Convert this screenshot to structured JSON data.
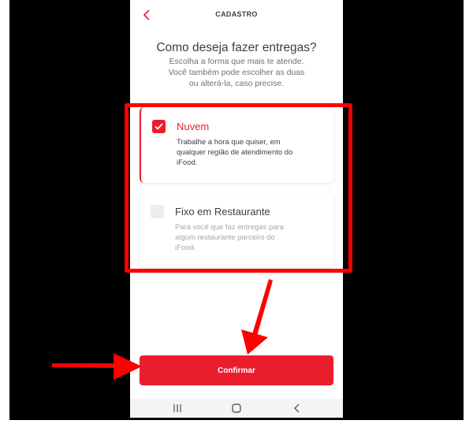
{
  "header": {
    "back_icon": "chevron-left-icon",
    "title": "CADASTRO"
  },
  "question": {
    "title": "Como deseja fazer entregas?",
    "subtitle_lines": [
      "Escolha a forma que mais te atende.",
      "Você também pode escolher as duas",
      "ou alterá-la, caso precise."
    ]
  },
  "options": [
    {
      "label": "Nuvem",
      "selected": true,
      "description_lines": [
        "Trabalhe a hora que quiser, em",
        "qualquer região de atendimento do",
        "iFood."
      ]
    },
    {
      "label": "Fixo em Restaurante",
      "selected": false,
      "description_lines": [
        "Para você que faz entregas para",
        "algum restaurante parceiro do",
        "iFood."
      ]
    }
  ],
  "confirm_button": {
    "label": "Confirmar"
  },
  "nav_bar": {
    "icons": [
      "recents-icon",
      "home-icon",
      "back-icon"
    ]
  },
  "colors": {
    "brand_red": "#ea1d2c",
    "annotation_red": "#ff0000",
    "frame": "#000000"
  }
}
